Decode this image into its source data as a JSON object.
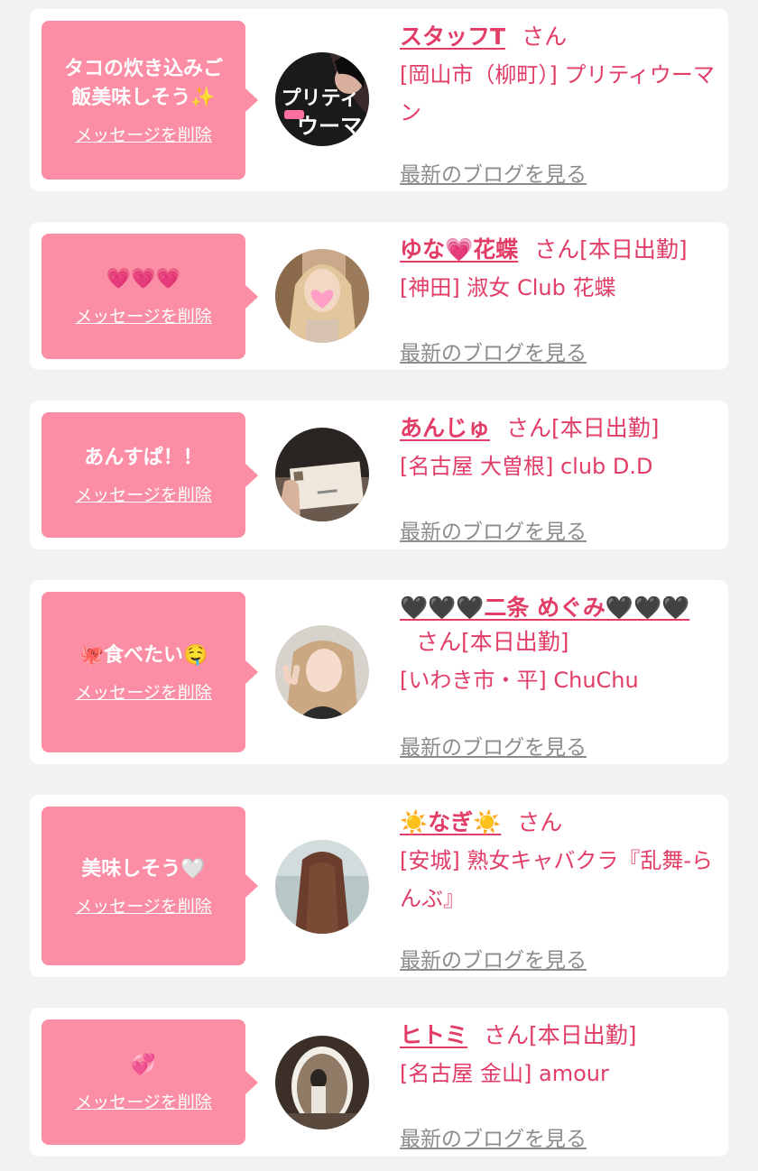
{
  "colors": {
    "page_bg": "#f2f2f2",
    "card_bg": "#ffffff",
    "bubble_bg": "#fb8ea4",
    "name_color": "#e13d66",
    "blog_link_color": "#8c8c8c"
  },
  "cards": [
    {
      "message": "タコの炊き込みご\n飯美味しそう✨",
      "delete_label": "メッセージを削除",
      "name": "スタッフT",
      "honorific": "さん",
      "status": "",
      "shop": "[岡山市（柳町）] プリティウーマン",
      "blog_label": "最新のブログを見る",
      "avatar": "pretty-woman-logo"
    },
    {
      "message": "💗💗💗",
      "delete_label": "メッセージを削除",
      "name": "ゆな💗花蝶",
      "honorific": "さん",
      "status": "[本日出勤]",
      "shop": "[神田] 淑女 Club 花蝶",
      "blog_label": "最新のブログを見る",
      "avatar": "woman-blonde-heart-sticker"
    },
    {
      "message": "あんすぱ！！",
      "delete_label": "メッセージを削除",
      "name": "あんじゅ",
      "honorific": "さん",
      "status": "[本日出勤]",
      "shop": "[名古屋 大曽根] club D.D",
      "blog_label": "最新のブログを見る",
      "avatar": "business-card-photo"
    },
    {
      "message": "🐙食べたい🤤",
      "delete_label": "メッセージを削除",
      "name": "🖤🖤🖤二条 めぐみ🖤🖤🖤",
      "honorific": "さん",
      "status": "[本日出勤]",
      "shop": "[いわき市・平] ChuChu",
      "blog_label": "最新のブログを見る",
      "avatar": "woman-peace-sign"
    },
    {
      "message": "美味しそう🤍",
      "delete_label": "メッセージを削除",
      "name": "☀️なぎ☀️",
      "honorific": "さん",
      "status": "",
      "shop": "[安城] 熟女キャバクラ『乱舞-らんぶ』",
      "blog_label": "最新のブログを見る",
      "avatar": "woman-long-hair-back"
    },
    {
      "message": "💞",
      "delete_label": "メッセージを削除",
      "name": "ヒトミ",
      "honorific": "さん",
      "status": "[本日出勤]",
      "shop": "[名古屋 金山] amour",
      "blog_label": "最新のブログを見る",
      "avatar": "mirror-selfie"
    }
  ]
}
